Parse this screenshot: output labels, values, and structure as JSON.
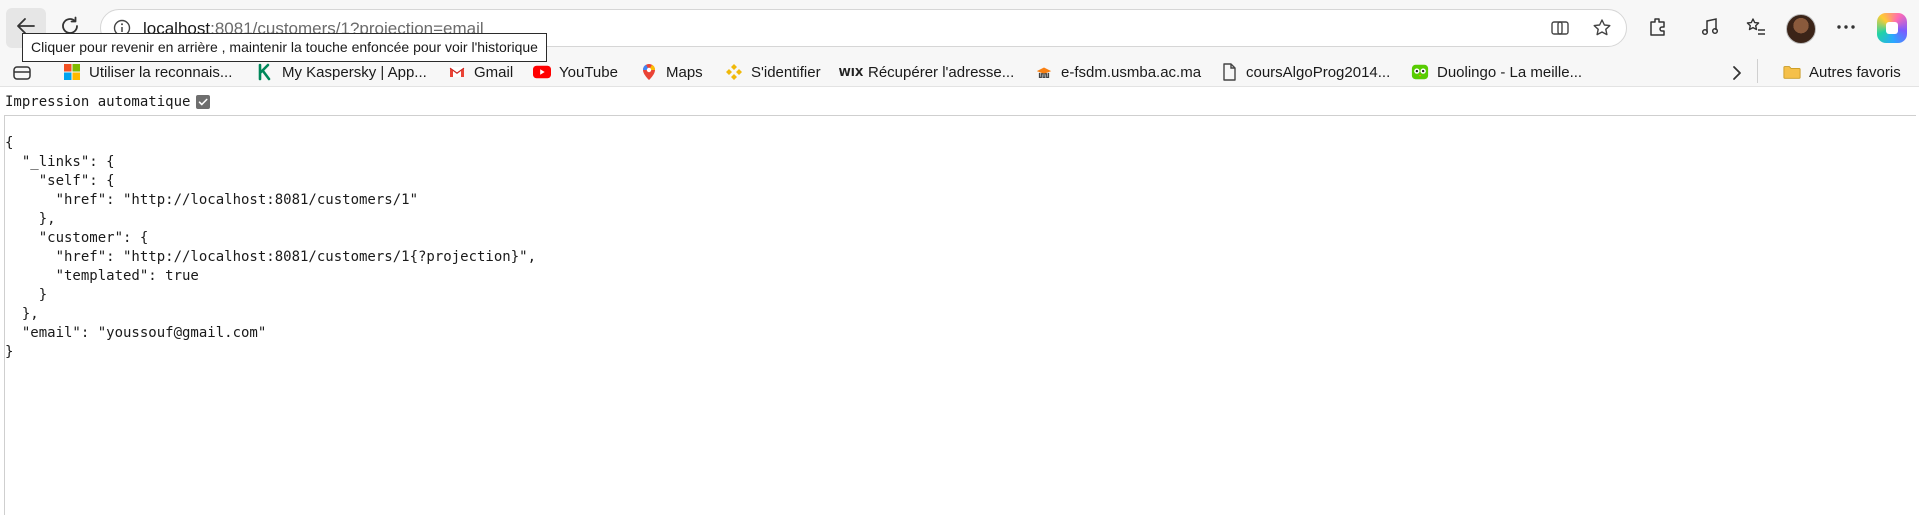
{
  "browser": {
    "url_host": "localhost",
    "url_path": ":8081/customers/1?projection=email",
    "back_tooltip": "Cliquer pour revenir en arrière , maintenir la touche enfoncée pour voir l'historique"
  },
  "favorites": [
    {
      "label": "Utiliser la reconnais...",
      "icon": "microsoft-icon"
    },
    {
      "label": "My Kaspersky | App...",
      "icon": "kaspersky-icon"
    },
    {
      "label": "Gmail",
      "icon": "gmail-icon"
    },
    {
      "label": "YouTube",
      "icon": "youtube-icon"
    },
    {
      "label": "Maps",
      "icon": "maps-pin-icon"
    },
    {
      "label": "S'identifier",
      "icon": "binance-icon"
    },
    {
      "label": "Récupérer l'adresse...",
      "icon": "wix-icon"
    },
    {
      "label": "e-fsdm.usmba.ac.ma",
      "icon": "moodle-icon"
    },
    {
      "label": "coursAlgoProg2014...",
      "icon": "document-icon"
    },
    {
      "label": "Duolingo - La meille...",
      "icon": "duolingo-icon"
    }
  ],
  "other_favorites_label": "Autres favoris",
  "page": {
    "autoprint_label": "Impression automatique",
    "autoprint_checked": true,
    "json_lines": [
      "{",
      "  \"_links\": {",
      "    \"self\": {",
      "      \"href\": \"http://localhost:8081/customers/1\"",
      "    },",
      "    \"customer\": {",
      "      \"href\": \"http://localhost:8081/customers/1{?projection}\",",
      "      \"templated\": true",
      "    }",
      "  },",
      "  \"email\": \"youssouf@gmail.com\"",
      "}"
    ]
  }
}
